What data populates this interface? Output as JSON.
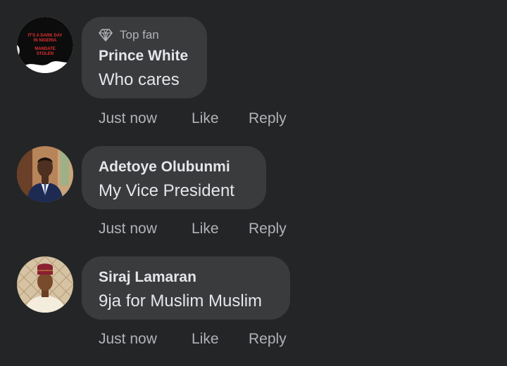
{
  "comments": [
    {
      "badge": "Top fan",
      "author": "Prince White",
      "text": "Who cares",
      "time": "Just now",
      "like": "Like",
      "reply": "Reply",
      "avatar_text": [
        "IT'S A DARK DAY",
        "IN NIGERIA",
        "MANDATE",
        "STOLEN"
      ]
    },
    {
      "author": "Adetoye Olubunmi",
      "text": "My Vice President",
      "time": "Just now",
      "like": "Like",
      "reply": "Reply"
    },
    {
      "author": "Siraj Lamaran",
      "text": "9ja for Muslim Muslim",
      "time": "Just now",
      "like": "Like",
      "reply": "Reply"
    }
  ],
  "colors": {
    "background": "#242526",
    "bubble": "#3a3b3c",
    "primary_text": "#e4e6eb",
    "secondary_text": "#b0b3b8"
  },
  "icons": {
    "top_fan_badge": "diamond-icon"
  }
}
